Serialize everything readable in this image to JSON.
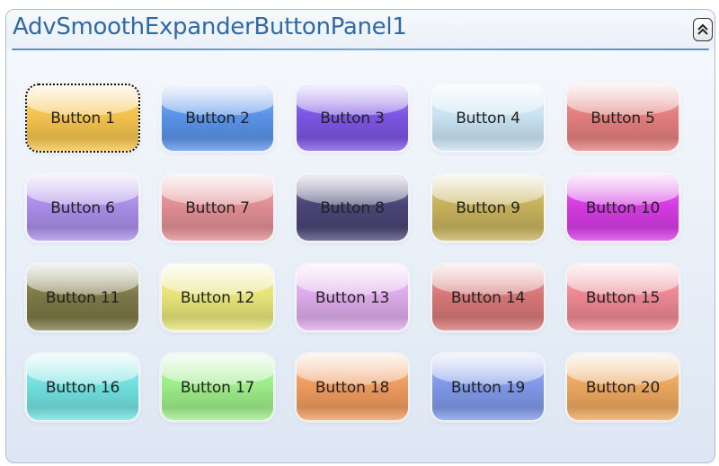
{
  "panel": {
    "title": "AdvSmoothExpanderButtonPanel1",
    "collapse_icon": "double-chevron-up-icon"
  },
  "buttons": [
    {
      "label": "Button 1",
      "color": "#f4c34e",
      "focused": true
    },
    {
      "label": "Button 2",
      "color": "#5b93e8"
    },
    {
      "label": "Button 3",
      "color": "#7c55e2"
    },
    {
      "label": "Button 4",
      "color": "#c9e3f2"
    },
    {
      "label": "Button 5",
      "color": "#e37e7e"
    },
    {
      "label": "Button 6",
      "color": "#a98de8"
    },
    {
      "label": "Button 7",
      "color": "#e08e93"
    },
    {
      "label": "Button 8",
      "color": "#4a4575"
    },
    {
      "label": "Button 9",
      "color": "#c6b25c"
    },
    {
      "label": "Button 10",
      "color": "#d53be3"
    },
    {
      "label": "Button 11",
      "color": "#7d7847"
    },
    {
      "label": "Button 12",
      "color": "#e6e479"
    },
    {
      "label": "Button 13",
      "color": "#ddaaea"
    },
    {
      "label": "Button 14",
      "color": "#d77777"
    },
    {
      "label": "Button 15",
      "color": "#ec8792"
    },
    {
      "label": "Button 16",
      "color": "#72e0e0"
    },
    {
      "label": "Button 17",
      "color": "#9eec89"
    },
    {
      "label": "Button 18",
      "color": "#ee9b5f"
    },
    {
      "label": "Button 19",
      "color": "#7f98e8"
    },
    {
      "label": "Button 20",
      "color": "#eca75e"
    }
  ]
}
